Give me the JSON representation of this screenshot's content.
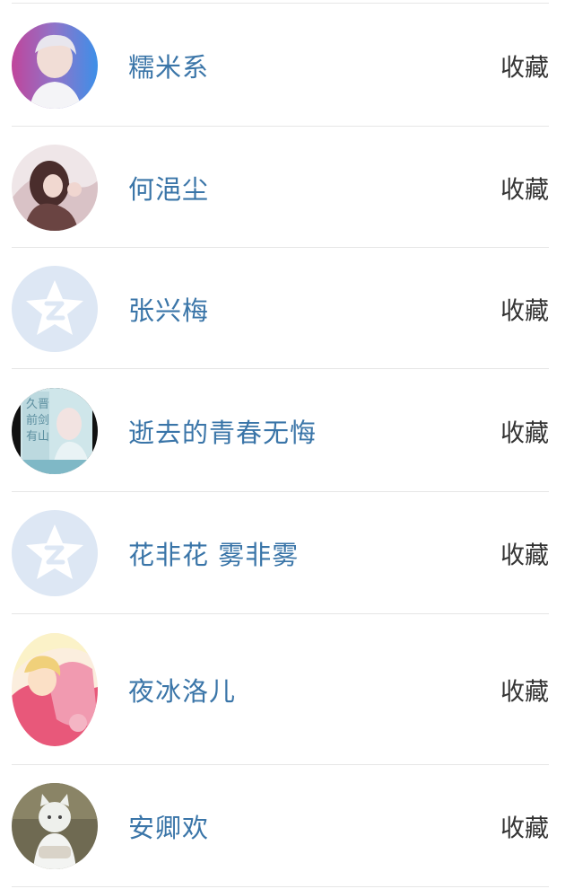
{
  "contacts": [
    {
      "name": "糯米系",
      "action": "收藏",
      "avatar": "photo-avatar-icon"
    },
    {
      "name": "何浥尘",
      "action": "收藏",
      "avatar": "photo-avatar-icon"
    },
    {
      "name": "张兴梅",
      "action": "收藏",
      "avatar": "default-qzone-avatar-icon"
    },
    {
      "name": "逝去的青春无悔",
      "action": "收藏",
      "avatar": "photo-avatar-icon"
    },
    {
      "name": "花非花 雾非雾",
      "action": "收藏",
      "avatar": "default-qzone-avatar-icon"
    },
    {
      "name": "夜冰洛儿",
      "action": "收藏",
      "avatar": "photo-avatar-icon"
    },
    {
      "name": "安卿欢",
      "action": "收藏",
      "avatar": "photo-avatar-icon"
    }
  ],
  "colors": {
    "name_text": "#3a75a8",
    "action_text": "#333333",
    "divider": "#e6e6e6",
    "default_avatar_bg": "#dde7f4"
  }
}
